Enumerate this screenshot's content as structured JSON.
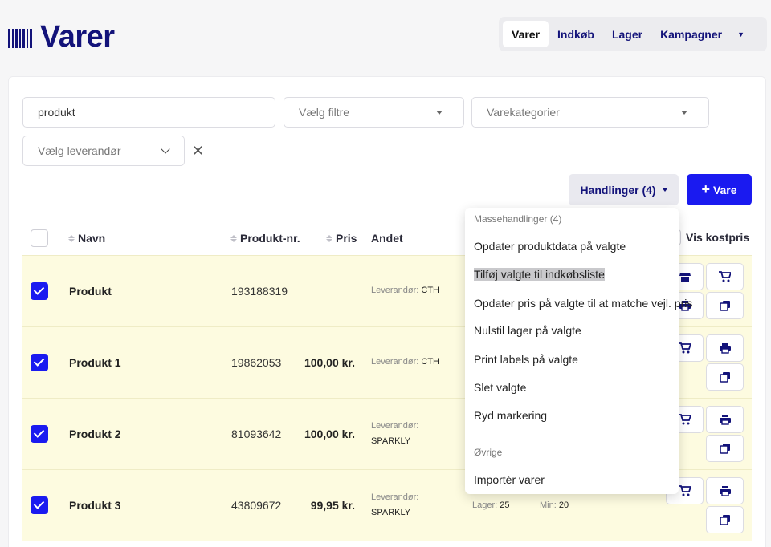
{
  "app": {
    "title": "Varer"
  },
  "nav": {
    "tabs": [
      "Varer",
      "Indkøb",
      "Lager",
      "Kampagner"
    ],
    "active": "Varer"
  },
  "filters": {
    "search_value": "produkt",
    "filter_placeholder": "Vælg filtre",
    "category_placeholder": "Varekategorier",
    "supplier_placeholder": "Vælg leverandør"
  },
  "toolbar": {
    "actions_label": "Handlinger (4)",
    "add_label": "Vare"
  },
  "table": {
    "columns": {
      "name": "Navn",
      "product_no": "Produkt-nr.",
      "price": "Pris",
      "other": "Andet",
      "show_cost": "Vis kostpris"
    },
    "supplier_label": "Leverandør:",
    "stock_label": "Lager:",
    "min_label": "Min:",
    "rows": [
      {
        "name": "Produkt",
        "product_no": "193188319",
        "price": "",
        "supplier": "CTH"
      },
      {
        "name": "Produkt 1",
        "product_no": "19862053",
        "price": "100,00 kr.",
        "supplier": "CTH"
      },
      {
        "name": "Produkt 2",
        "product_no": "81093642",
        "price": "100,00 kr.",
        "supplier": "SPARKLY"
      },
      {
        "name": "Produkt 3",
        "product_no": "43809672",
        "price": "99,95 kr.",
        "supplier": "SPARKLY",
        "stock": "25",
        "min": "20"
      }
    ]
  },
  "menu": {
    "header_bulk": "Massehandlinger (4)",
    "items": [
      "Opdater produktdata på valgte",
      "Tilføj valgte til indkøbsliste",
      "Opdater pris på valgte til at matche vejl. pris",
      "Nulstil lager på valgte",
      "Print labels på valgte",
      "Slet valgte",
      "Ryd markering"
    ],
    "highlighted_index": 1,
    "header_other": "Øvrige",
    "other_items": [
      "Importér varer"
    ]
  },
  "colors": {
    "brand": "#13137a",
    "accent": "#1a1af0",
    "row_selected": "#fdfbe0"
  }
}
